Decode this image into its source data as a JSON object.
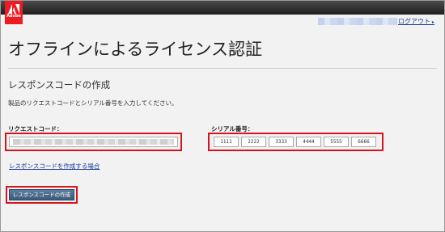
{
  "header": {
    "logo_text": "Adobe",
    "logout_label": "ログアウト"
  },
  "page": {
    "title": "オフラインによるライセンス認証"
  },
  "section": {
    "title": "レスポンスコードの作成",
    "description": "製品のリクエストコードとシリアル番号を入力してください。"
  },
  "request_code": {
    "label": "リクエストコード："
  },
  "serial": {
    "label": "シリアル番号：",
    "fields": [
      "1111",
      "2222",
      "3333",
      "4444",
      "5555",
      "6666"
    ]
  },
  "help_link": "レスポンスコードを作成する場合",
  "submit_button": "レスポンスコードの作成",
  "colors": {
    "highlight": "#d6141b",
    "brand": "#ed1c24",
    "link": "#1a3c9a",
    "button": "#4a6a8a"
  },
  "icons": {
    "logo": "adobe-logo"
  }
}
